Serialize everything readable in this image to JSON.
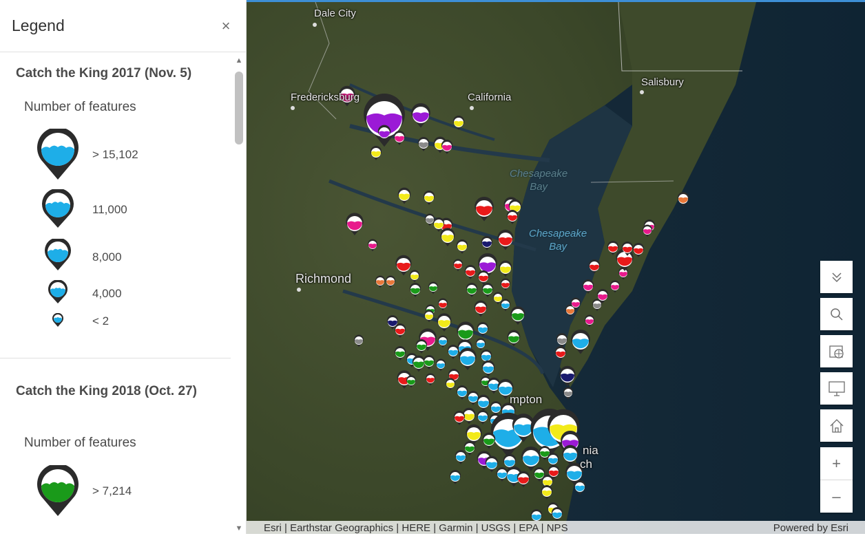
{
  "legend": {
    "title": "Legend",
    "close_glyph": "×",
    "sections": [
      {
        "title": "Catch the King 2017 (Nov. 5)",
        "subtitle": "Number of features",
        "color": "#1eaee8",
        "rows": [
          {
            "label": "> 15,102"
          },
          {
            "label": "11,000"
          },
          {
            "label": "8,000"
          },
          {
            "label": "4,000"
          },
          {
            "label": "< 2"
          }
        ]
      },
      {
        "title": "Catch the King 2018 (Oct. 27)",
        "subtitle": "Number of features",
        "color": "#1a9a1a",
        "rows": [
          {
            "label": "> 7,214"
          }
        ]
      }
    ]
  },
  "map": {
    "labels": {
      "dale_city": "Dale City",
      "fredericksburg": "Fredericksburg",
      "california": "California",
      "salisbury": "Salisbury",
      "richmond": "Richmond",
      "hampton": "mpton",
      "virginia_beach": "nia",
      "beach2": "ch"
    },
    "water_labels": {
      "chesapeake_1": "Chesapeake",
      "bay_1": "Bay",
      "chesapeake_2": "Chesapeake",
      "bay_2": "Bay"
    },
    "colors": {
      "blue": "#1eaee8",
      "green": "#1a9a1a",
      "red": "#e81a1a",
      "yellow": "#f2ea1a",
      "magenta": "#e81a8c",
      "purple": "#9b1ad6",
      "orange": "#e8783a",
      "gray": "#8a8a8a",
      "navy": "#1a1a6e"
    }
  },
  "widgets": {
    "collapse": "collapse-icon",
    "search": "search-icon",
    "basemap": "basemap-icon",
    "fullscreen": "fullscreen-icon",
    "home": "home-icon",
    "zoom_in": "+",
    "zoom_out": "–"
  },
  "attribution": {
    "left": "Esri | Earthstar Geographics | HERE | Garmin | USGS | EPA | NPS",
    "right": "Powered by Esri"
  }
}
